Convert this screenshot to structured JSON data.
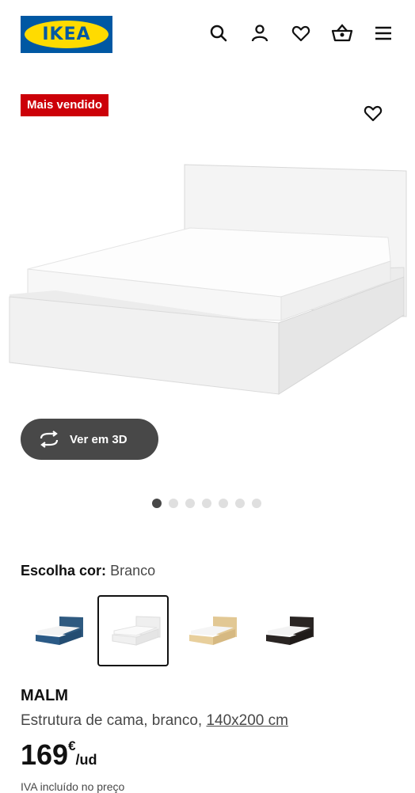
{
  "header": {
    "logo_text": "IKEA",
    "icons": [
      "search-icon",
      "user-icon",
      "heart-icon",
      "basket-icon",
      "menu-icon"
    ]
  },
  "badge": {
    "label": "Mais vendido"
  },
  "gallery": {
    "favorite_icon": "heart-icon",
    "view3d_label": "Ver em 3D",
    "dots_total": 7,
    "active_dot": 1
  },
  "color_selector": {
    "label": "Escolha cor:",
    "selected": "Branco",
    "options": [
      "blue",
      "white",
      "oak",
      "black"
    ],
    "selected_index": 1
  },
  "product": {
    "name": "MALM",
    "description": "Estrutura de cama, branco, ",
    "size_link": "140x200 cm",
    "price": "169",
    "currency": "€",
    "unit": "/ud",
    "vat_note": "IVA incluído no preço"
  },
  "colors": {
    "ikea_blue": "#0058a3",
    "ikea_yellow": "#ffdb00",
    "badge_red": "#cc0008",
    "button_dark": "#484848"
  }
}
